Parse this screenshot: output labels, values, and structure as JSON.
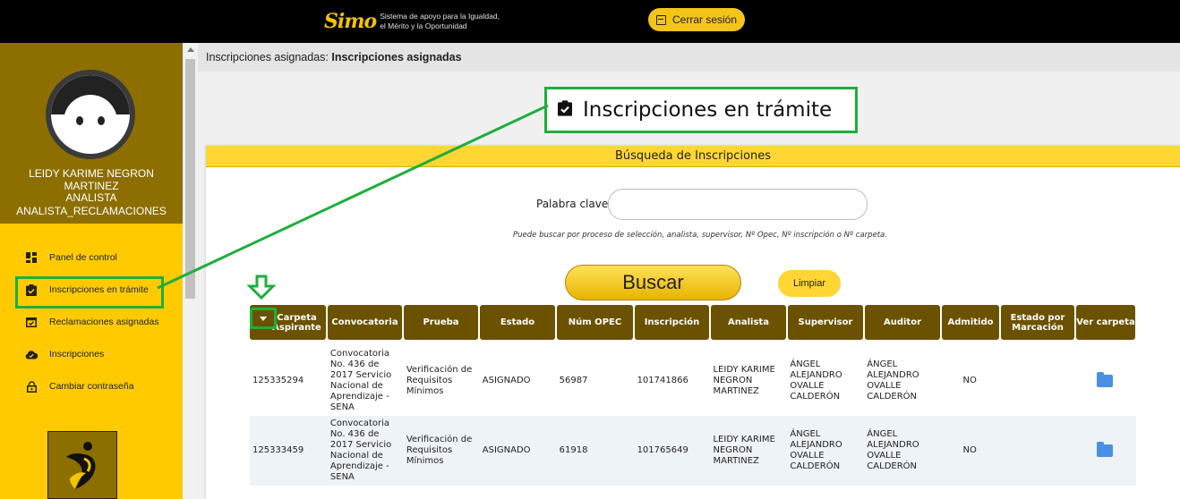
{
  "header": {
    "logo_mark": "Simo",
    "logo_text": "Sistema de apoyo para la Igualdad,\nel Mérito y la Oportunidad",
    "logout_label": "Cerrar sesión"
  },
  "sidebar": {
    "user_name": "LEIDY KARIME NEGRON MARTINEZ",
    "role_line1": "ANALISTA",
    "role_line2": "ANALISTA_RECLAMACIONES",
    "items": [
      {
        "label": "Panel de control",
        "icon": "dashboard-icon"
      },
      {
        "label": "Inscripciones en trámite",
        "icon": "clipboard-check-icon"
      },
      {
        "label": "Reclamaciones asignadas",
        "icon": "calendar-check-icon"
      },
      {
        "label": "Inscripciones",
        "icon": "cloud-check-icon"
      },
      {
        "label": "Cambiar contraseña",
        "icon": "lock-icon"
      }
    ]
  },
  "breadcrumb": {
    "prefix": "Inscripciones asignadas:",
    "current": "Inscripciones asignadas"
  },
  "page_title": "Inscripciones en trámite",
  "search": {
    "panel_title": "Búsqueda de Inscripciones",
    "keyword_label": "Palabra clave",
    "keyword_value": "",
    "hint": "Puede buscar por proceso de selección, analista, supervisor, Nº Opec, Nº inscripción o Nº carpeta.",
    "search_button": "Buscar",
    "clear_button": "Limpiar"
  },
  "table": {
    "columns": [
      "Carpeta Aspirante",
      "Convocatoria",
      "Prueba",
      "Estado",
      "Núm OPEC",
      "Inscripción",
      "Analista",
      "Supervisor",
      "Auditor",
      "Admitido",
      "Estado por Marcación",
      "Ver carpeta"
    ],
    "rows": [
      {
        "carpeta": "125335294",
        "convocatoria": "Convocatoria No. 436 de 2017 Servicio Nacional de Aprendizaje - SENA",
        "prueba": "Verificación de Requisitos Mínimos",
        "estado": "ASIGNADO",
        "opec": "56987",
        "inscripcion": "101741866",
        "analista": "LEIDY KARIME NEGRON MARTINEZ",
        "supervisor": "ÁNGEL ALEJANDRO OVALLE CALDERÓN",
        "auditor": "ÁNGEL ALEJANDRO OVALLE CALDERÓN",
        "admitido": "NO",
        "marcacion": ""
      },
      {
        "carpeta": "125333459",
        "convocatoria": "Convocatoria No. 436 de 2017 Servicio Nacional de Aprendizaje - SENA",
        "prueba": "Verificación de Requisitos Mínimos",
        "estado": "ASIGNADO",
        "opec": "61918",
        "inscripcion": "101765649",
        "analista": "LEIDY KARIME NEGRON MARTINEZ",
        "supervisor": "ÁNGEL ALEJANDRO OVALLE CALDERÓN",
        "auditor": "ÁNGEL ALEJANDRO OVALLE CALDERÓN",
        "admitido": "NO",
        "marcacion": ""
      }
    ]
  },
  "colors": {
    "sidebar_bg": "#ffcb00",
    "profile_bg": "#8c6f00",
    "table_header": "#6b5200",
    "annotation_green": "#1fae3c",
    "accent_yellow": "#ffd634"
  }
}
